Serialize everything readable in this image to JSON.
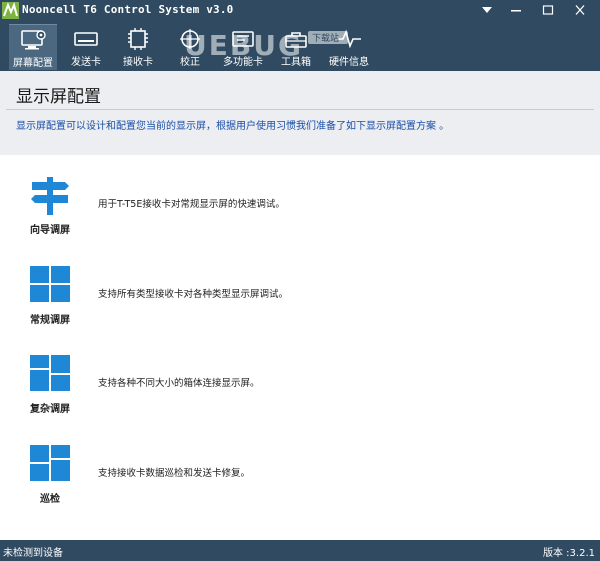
{
  "window": {
    "title": "Nooncell T6 Control System v3.0",
    "controls": [
      "dropdown-icon",
      "minimize-icon",
      "maximize-icon",
      "close-icon"
    ]
  },
  "toolbar": {
    "items": [
      {
        "label": "屏幕配置",
        "icon": "monitor-gear-icon",
        "active": true
      },
      {
        "label": "发送卡",
        "icon": "sender-card-icon",
        "active": false
      },
      {
        "label": "接收卡",
        "icon": "receiver-card-icon",
        "active": false
      },
      {
        "label": "校正",
        "icon": "calibration-icon",
        "active": false
      },
      {
        "label": "多功能卡",
        "icon": "multifunction-card-icon",
        "active": false
      },
      {
        "label": "工具箱",
        "icon": "toolbox-icon",
        "active": false
      },
      {
        "label": "硬件信息",
        "icon": "hardware-info-icon",
        "active": false
      }
    ]
  },
  "watermark": {
    "text": "UEBUG",
    "badge": "下载站"
  },
  "header": {
    "title": "显示屏配置",
    "description": "显示屏配置可以设计和配置您当前的显示屏，根据用户使用习惯我们准备了如下显示屏配置方案 。"
  },
  "options": [
    {
      "name": "向导调屏",
      "description": "用于T-T5E接收卡对常规显示屏的快速调试。",
      "icon": "signpost-icon"
    },
    {
      "name": "常规调屏",
      "description": "支持所有类型接收卡对各种类型显示屏调试。",
      "icon": "four-grid-icon"
    },
    {
      "name": "复杂调屏",
      "description": "支持各种不同大小的箱体连接显示屏。",
      "icon": "uneven-grid-icon"
    },
    {
      "name": "巡检",
      "description": "支持接收卡数据巡检和发送卡修复。",
      "icon": "split-grid-icon"
    }
  ],
  "status": {
    "left": "未检测到设备",
    "right": "版本 :3.2.1"
  },
  "colors": {
    "chrome": "#2f4a61",
    "active_tab": "#4b6880",
    "accent_blue": "#1e88d6",
    "desc_blue": "#1a4ea8",
    "header_bg": "#eceef1"
  }
}
